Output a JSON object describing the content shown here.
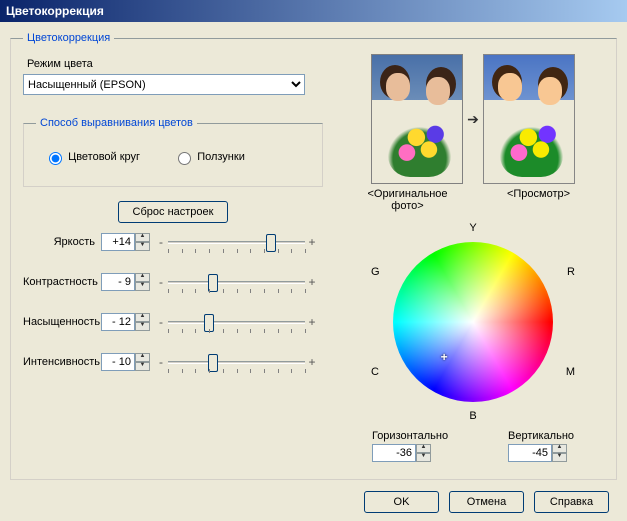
{
  "window": {
    "title": "Цветокоррекция"
  },
  "group": {
    "title": "Цветокоррекция"
  },
  "mode": {
    "label": "Режим цвета",
    "selected": "Насыщенный (EPSON)"
  },
  "balance_method": {
    "title": "Способ выравнивания цветов",
    "wheel_label": "Цветовой круг",
    "sliders_label": "Ползунки",
    "selected": "wheel"
  },
  "reset": {
    "label": "Сброс настроек"
  },
  "sliders": {
    "brightness": {
      "label": "Яркость",
      "value": "+14",
      "pos": 0.75
    },
    "contrast": {
      "label": "Контрастность",
      "value": "- 9",
      "pos": 0.33
    },
    "saturation": {
      "label": "Насыщенность",
      "value": "- 12",
      "pos": 0.3
    },
    "intensity": {
      "label": "Интенсивность",
      "value": "- 10",
      "pos": 0.33
    }
  },
  "previews": {
    "original_caption": "<Оригинальное фото>",
    "preview_caption": "<Просмотр>"
  },
  "wheel": {
    "labels": {
      "Y": "Y",
      "G": "G",
      "R": "R",
      "C": "C",
      "M": "M",
      "B": "B"
    },
    "horizontal": {
      "label": "Горизонтально",
      "value": "-36"
    },
    "vertical": {
      "label": "Вертикально",
      "value": "-45"
    },
    "cross_x": 0.32,
    "cross_y": 0.72
  },
  "buttons": {
    "ok": "OK",
    "cancel": "Отмена",
    "help": "Справка"
  }
}
